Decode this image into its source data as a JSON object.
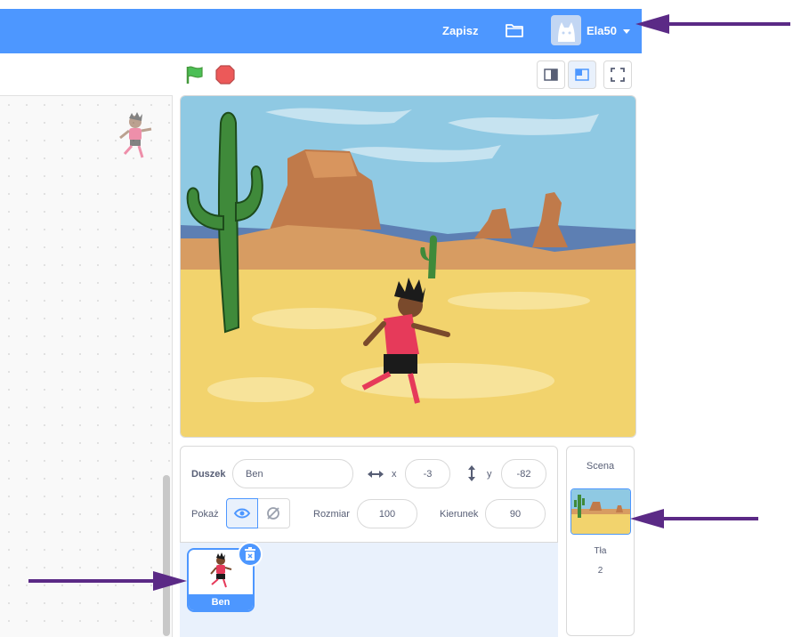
{
  "menubar": {
    "save_label": "Zapisz",
    "username": "Ela50",
    "icons": [
      "folder-icon",
      "avatar-icon",
      "caret-down-icon"
    ],
    "accent_color": "#4d97ff"
  },
  "controls": {
    "icons": [
      "green-flag-icon",
      "stop-icon",
      "small-stage-icon",
      "normal-stage-icon",
      "fullscreen-icon"
    ]
  },
  "sprite_info": {
    "sprite_label": "Duszek",
    "sprite_name": "Ben",
    "x_label": "x",
    "x_value": "-3",
    "y_label": "y",
    "y_value": "-82",
    "show_label": "Pokaż",
    "size_label": "Rozmiar",
    "size_value": "100",
    "direction_label": "Kierunek",
    "direction_value": "90"
  },
  "sprite_list": {
    "items": [
      {
        "name": "Ben",
        "selected": true
      }
    ]
  },
  "stage_pane": {
    "title": "Scena",
    "backdrops_label": "Tła",
    "backdrops_count": "2"
  }
}
